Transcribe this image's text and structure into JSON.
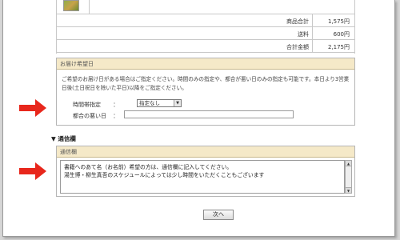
{
  "summary": {
    "rows": [
      {
        "label": "商品合計",
        "value": "1,575円"
      },
      {
        "label": "送料",
        "value": "600円"
      },
      {
        "label": "合計金額",
        "value": "2,175円"
      }
    ]
  },
  "delivery": {
    "header": "お届け希望日",
    "description": "ご希望のお届け日がある場合はご指定ください。時間のみの指定や、都合が悪い日のみの指定も可能です。本日より3営業日後(土日祝日を除いた平日)以降をご指定ください。",
    "time_label": "時間帯指定",
    "colon": "：",
    "time_selected": "指定なし",
    "bad_day_label": "都合の悪い日",
    "bad_day_colon": "："
  },
  "comm": {
    "title": "▼ 通信欄",
    "header": "通信欄",
    "text_line1": "書籍へのあて名（お名前）希望の方は、通信欄に記入してください。",
    "text_line2": "湯生博・柳生真吾のスケジュールによっては少し時間をいただくこともございます"
  },
  "next_label": "次へ",
  "colors": {
    "arrow": "#e8271c",
    "section_header": "#f5e9c8"
  }
}
